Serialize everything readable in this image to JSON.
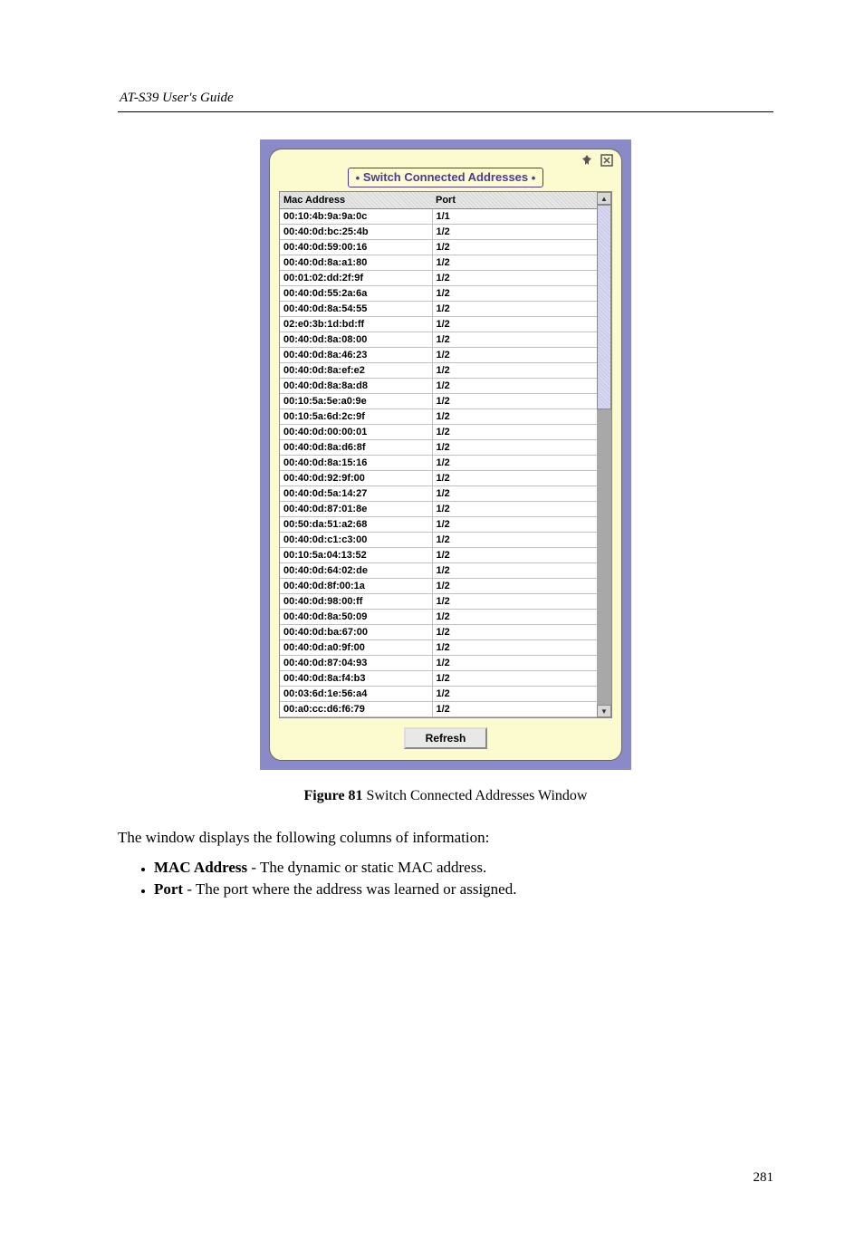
{
  "header": {
    "left": "AT-S39 User's Guide",
    "right": ""
  },
  "panel": {
    "title": "Switch Connected Addresses",
    "columns": [
      "Mac Address",
      "Port"
    ],
    "rows": [
      {
        "mac": "00:10:4b:9a:9a:0c",
        "port": "1/1"
      },
      {
        "mac": "00:40:0d:bc:25:4b",
        "port": "1/2"
      },
      {
        "mac": "00:40:0d:59:00:16",
        "port": "1/2"
      },
      {
        "mac": "00:40:0d:8a:a1:80",
        "port": "1/2"
      },
      {
        "mac": "00:01:02:dd:2f:9f",
        "port": "1/2"
      },
      {
        "mac": "00:40:0d:55:2a:6a",
        "port": "1/2"
      },
      {
        "mac": "00:40:0d:8a:54:55",
        "port": "1/2"
      },
      {
        "mac": "02:e0:3b:1d:bd:ff",
        "port": "1/2"
      },
      {
        "mac": "00:40:0d:8a:08:00",
        "port": "1/2"
      },
      {
        "mac": "00:40:0d:8a:46:23",
        "port": "1/2"
      },
      {
        "mac": "00:40:0d:8a:ef:e2",
        "port": "1/2"
      },
      {
        "mac": "00:40:0d:8a:8a:d8",
        "port": "1/2"
      },
      {
        "mac": "00:10:5a:5e:a0:9e",
        "port": "1/2"
      },
      {
        "mac": "00:10:5a:6d:2c:9f",
        "port": "1/2"
      },
      {
        "mac": "00:40:0d:00:00:01",
        "port": "1/2"
      },
      {
        "mac": "00:40:0d:8a:d6:8f",
        "port": "1/2"
      },
      {
        "mac": "00:40:0d:8a:15:16",
        "port": "1/2"
      },
      {
        "mac": "00:40:0d:92:9f:00",
        "port": "1/2"
      },
      {
        "mac": "00:40:0d:5a:14:27",
        "port": "1/2"
      },
      {
        "mac": "00:40:0d:87:01:8e",
        "port": "1/2"
      },
      {
        "mac": "00:50:da:51:a2:68",
        "port": "1/2"
      },
      {
        "mac": "00:40:0d:c1:c3:00",
        "port": "1/2"
      },
      {
        "mac": "00:10:5a:04:13:52",
        "port": "1/2"
      },
      {
        "mac": "00:40:0d:64:02:de",
        "port": "1/2"
      },
      {
        "mac": "00:40:0d:8f:00:1a",
        "port": "1/2"
      },
      {
        "mac": "00:40:0d:98:00:ff",
        "port": "1/2"
      },
      {
        "mac": "00:40:0d:8a:50:09",
        "port": "1/2"
      },
      {
        "mac": "00:40:0d:ba:67:00",
        "port": "1/2"
      },
      {
        "mac": "00:40:0d:a0:9f:00",
        "port": "1/2"
      },
      {
        "mac": "00:40:0d:87:04:93",
        "port": "1/2"
      },
      {
        "mac": "00:40:0d:8a:f4:b3",
        "port": "1/2"
      },
      {
        "mac": "00:03:6d:1e:56:a4",
        "port": "1/2"
      },
      {
        "mac": "00:a0:cc:d6:f6:79",
        "port": "1/2"
      }
    ],
    "refresh_label": "Refresh"
  },
  "caption": {
    "label": "Figure 81",
    "text": "   Switch Connected Addresses Window"
  },
  "body_intro": "The window displays the following columns of information:",
  "bullets": [
    {
      "term": "MAC Address",
      "desc": " - The dynamic or static MAC address."
    },
    {
      "term": "Port",
      "desc": " - The port where the address was learned or assigned."
    }
  ],
  "page_number": "281"
}
